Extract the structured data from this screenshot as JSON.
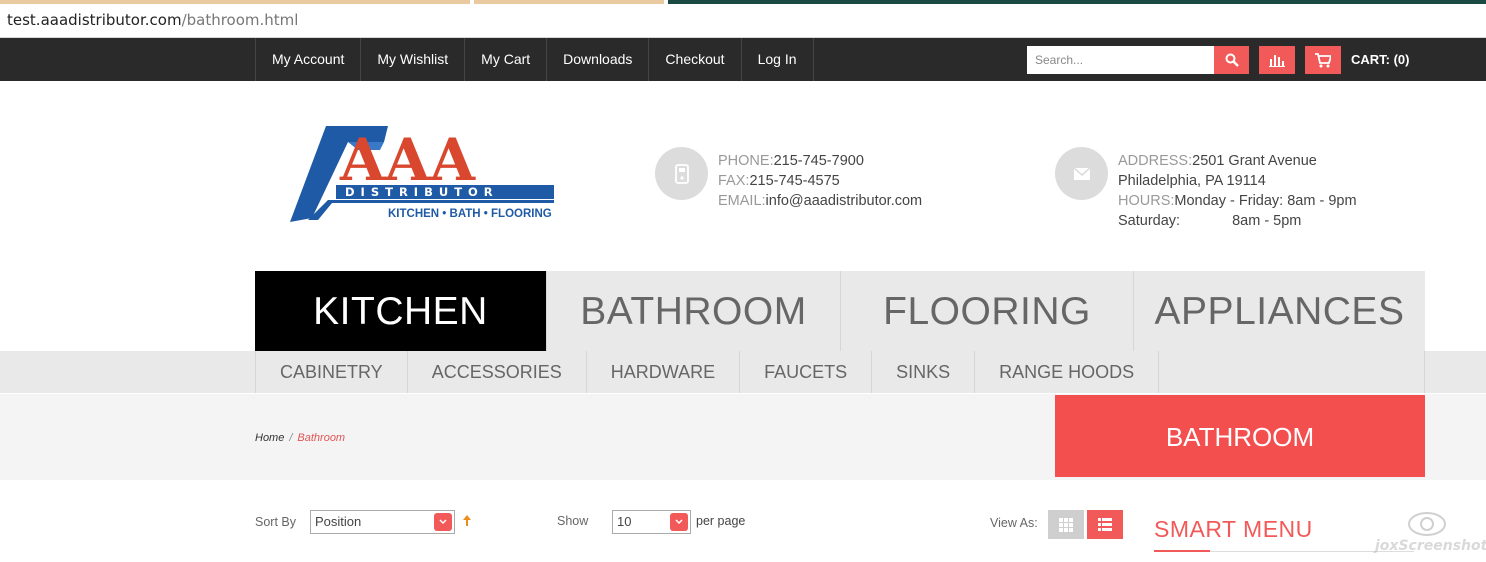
{
  "browser": {
    "url_host": "test.aaadistributor.com",
    "url_path": "/bathroom.html"
  },
  "topbar": {
    "links": [
      "My Account",
      "My Wishlist",
      "My Cart",
      "Downloads",
      "Checkout",
      "Log In"
    ],
    "search_placeholder": "Search...",
    "cart_label": "CART: (0)"
  },
  "logo": {
    "brand": "AAA",
    "sub": "DISTRIBUTOR",
    "tagline": "KITCHEN • BATH • FLOORING"
  },
  "contact": {
    "phone_label": "PHONE:",
    "phone": "215-745-7900",
    "fax_label": "FAX:",
    "fax": "215-745-4575",
    "email_label": "EMAIL:",
    "email": "info@aaadistributor.com"
  },
  "address": {
    "address_label": "ADDRESS:",
    "line1": "2501 Grant Avenue",
    "line2": "Philadelphia, PA 19114",
    "hours_label": "HOURS:",
    "hours": "Monday - Friday: 8am - 9pm",
    "sat_label": "Saturday:",
    "sat_hours": "8am - 5pm"
  },
  "mainnav": [
    "KITCHEN",
    "BATHROOM",
    "FLOORING",
    "APPLIANCES"
  ],
  "subnav": [
    "CABINETRY",
    "ACCESSORIES",
    "HARDWARE",
    "FAUCETS",
    "SINKS",
    "RANGE HOODS"
  ],
  "breadcrumb": {
    "home": "Home",
    "sep": "/",
    "current": "Bathroom"
  },
  "category_title": "BATHROOM",
  "toolbar": {
    "sort_label": "Sort By",
    "sort_value": "Position",
    "show_label": "Show",
    "show_value": "10",
    "per_page": "per page",
    "view_label": "View As:"
  },
  "smart_menu_title": "SMART MENU",
  "watermark_text": "joxScreenshot",
  "colors": {
    "accent": "#f25a5a",
    "topbar": "#2a2a2a",
    "nav_bg": "#e9e9e9"
  }
}
